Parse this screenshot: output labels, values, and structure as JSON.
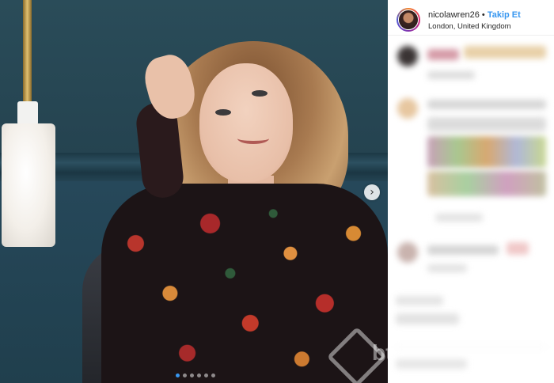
{
  "post": {
    "username": "nicolawren26",
    "separator": "•",
    "follow_label": "Takip Et",
    "location": "London, United Kingdom",
    "carousel": {
      "total_slides": 6,
      "active_slide": 1
    },
    "watermark": "bt"
  },
  "colors": {
    "follow_blue": "#3897f0",
    "wall_teal": "#24424f"
  },
  "icons": {
    "next": "chevron-right-icon"
  }
}
